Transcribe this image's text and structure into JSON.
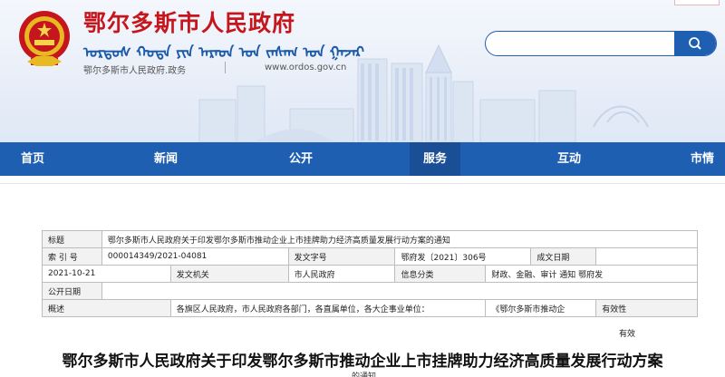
{
  "header": {
    "title": "鄂尔多斯市人民政府",
    "mongolian": "ᠣᠷᠳᠣᠰ ᠬᠣᠲᠠ ᠶᠢᠨ ᠠᠷᠠᠳ ᠤᠨ ᠵᠠᠰᠠᠭ ᠤᠨ ᠭᠠᠵᠠᠷ",
    "domain_cn": "鄂尔多斯市人民政府.政务",
    "domain_en": "www.ordos.gov.cn"
  },
  "search": {
    "placeholder": "",
    "button_icon": "search-icon"
  },
  "nav": {
    "items": [
      {
        "label": "首页"
      },
      {
        "label": "新闻"
      },
      {
        "label": "公开"
      },
      {
        "label": "服务"
      },
      {
        "label": "互动"
      },
      {
        "label": "市情"
      }
    ],
    "active_index": 3
  },
  "info": {
    "r1": {
      "label": "标题",
      "value": "鄂尔多斯市人民政府关于印发鄂尔多斯市推动企业上市挂牌助力经济高质量发展行动方案的通知"
    },
    "r2": {
      "label": "索 引 号",
      "value": "000014349/2021-04081",
      "label2": "发文字号",
      "value2": "鄂府发〔2021〕306号",
      "label3": "成文日期"
    },
    "r3": {
      "value0": "2021-10-21",
      "label": "发文机关",
      "value": "市人民政府",
      "label2": "信息分类",
      "value2": "财政、金融、审计 通知 鄂府发"
    },
    "r4": {
      "label": "公开日期"
    },
    "r5": {
      "label": "概述",
      "value": "各旗区人民政府，市人民政府各部门，各直属单位，各大企事业单位：",
      "value2": "《鄂尔多斯市推动企",
      "label2": "有效性"
    }
  },
  "validity_value": "有效",
  "doc": {
    "title": "鄂尔多斯市人民政府关于印发鄂尔多斯市推动企业上市挂牌助力经济高质量发展行动方案",
    "title_cut": "的通知"
  },
  "colors": {
    "brand_red": "#c4161c",
    "nav_blue": "#1f5fb2",
    "nav_active": "#1a4f96"
  }
}
